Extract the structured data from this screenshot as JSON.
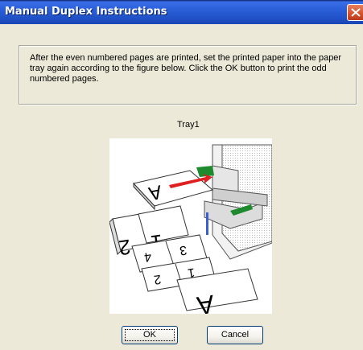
{
  "window": {
    "title": "Manual Duplex Instructions"
  },
  "instructions": {
    "text": "After the even numbered pages are printed, set the printed paper into the paper tray again according to the figure below. Click the OK button to print the odd numbered pages."
  },
  "figure": {
    "caption": "Tray1",
    "page_labels": [
      "A",
      "1",
      "2",
      "3",
      "4",
      "1",
      "2",
      "A"
    ]
  },
  "buttons": {
    "ok": "OK",
    "cancel": "Cancel"
  },
  "colors": {
    "titlebar": "#2a5fd8",
    "close": "#d4502c",
    "dialog_bg": "#ece9d8",
    "arrow_red": "#e02020",
    "arrow_green": "#1e8a2e"
  }
}
